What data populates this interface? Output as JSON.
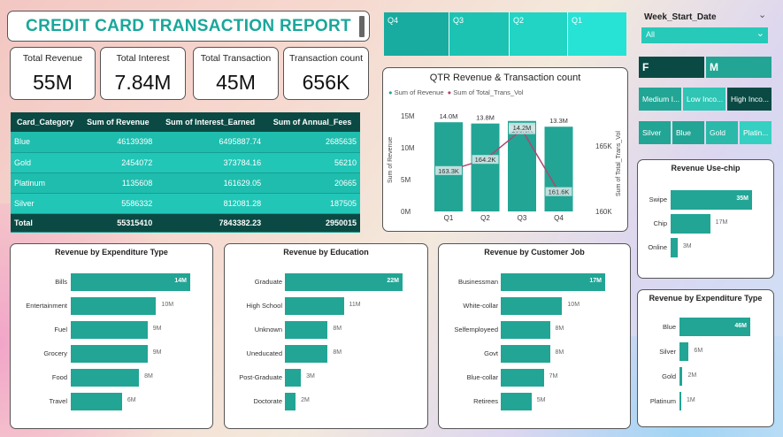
{
  "report": {
    "title": "CREDIT CARD TRANSACTION REPORT"
  },
  "kpis": [
    {
      "label": "Total Revenue",
      "value": "55M"
    },
    {
      "label": "Total Interest",
      "value": "7.84M"
    },
    {
      "label": "Total Transaction",
      "value": "45M"
    },
    {
      "label": "Transaction count",
      "value": "656K"
    }
  ],
  "table": {
    "headers": [
      "Card_Category",
      "Sum of Revenue",
      "Sum of Interest_Earned",
      "Sum of Annual_Fees"
    ],
    "rows": [
      [
        "Blue",
        "46139398",
        "6495887.74",
        "2685635"
      ],
      [
        "Gold",
        "2454072",
        "373784.16",
        "56210"
      ],
      [
        "Platinum",
        "1135608",
        "161629.05",
        "20665"
      ],
      [
        "Silver",
        "5586332",
        "812081.28",
        "187505"
      ]
    ],
    "total": [
      "Total",
      "55315410",
      "7843382.23",
      "2950015"
    ]
  },
  "quarter_slicer": [
    "Q4",
    "Q3",
    "Q2",
    "Q1"
  ],
  "week_slicer": {
    "label": "Week_Start_Date",
    "value": "All"
  },
  "gender_slicer": [
    "F",
    "M"
  ],
  "income_slicer": [
    "Medium I...",
    "Low Inco...",
    "High Inco..."
  ],
  "card_slicer": [
    "Silver",
    "Blue",
    "Gold",
    "Platin..."
  ],
  "qtr_chart": {
    "title": "QTR Revenue & Transaction count",
    "legend": [
      "Sum of Revenue",
      "Sum of Total_Trans_Vol"
    ],
    "ylabel_left": "Sum of Revenue",
    "ylabel_right": "Sum of Total_Trans_Vol",
    "left_ticks": [
      "15M",
      "10M",
      "5M",
      "0M"
    ],
    "right_ticks": [
      "165K",
      "160K"
    ]
  },
  "colors": {
    "teal": "#22a595",
    "dark_teal": "#0b4a44",
    "line": "#b0466f",
    "title": "#1aa79a"
  },
  "chart_data": [
    {
      "type": "bar+line",
      "title": "QTR Revenue & Transaction count",
      "categories": [
        "Q1",
        "Q2",
        "Q3",
        "Q4"
      ],
      "series": [
        {
          "name": "Sum of Revenue",
          "type": "bar",
          "values": [
            14.0,
            13.8,
            14.2,
            13.3
          ],
          "labels": [
            "14.0M",
            "13.8M",
            "14.2M",
            "13.3M"
          ]
        },
        {
          "name": "Sum of Total_Trans_Vol",
          "type": "line",
          "values": [
            163.3,
            164.2,
            166.6,
            161.6
          ],
          "labels": [
            "163.3K",
            "164.2K",
            "166.6K",
            "161.6K"
          ]
        }
      ],
      "ylim": [
        0,
        15
      ],
      "y2lim": [
        160,
        167
      ]
    },
    {
      "type": "bar",
      "title": "Revenue by Expenditure Type",
      "categories": [
        "Bills",
        "Entertainment",
        "Fuel",
        "Grocery",
        "Food",
        "Travel"
      ],
      "values": [
        14,
        10,
        9,
        9,
        8,
        6
      ],
      "labels": [
        "14M",
        "10M",
        "9M",
        "9M",
        "8M",
        "6M"
      ]
    },
    {
      "type": "bar",
      "title": "Revenue by Education",
      "categories": [
        "Graduate",
        "High School",
        "Unknown",
        "Uneducated",
        "Post-Graduate",
        "Doctorate"
      ],
      "values": [
        22,
        11,
        8,
        8,
        3,
        2
      ],
      "labels": [
        "22M",
        "11M",
        "8M",
        "8M",
        "3M",
        "2M"
      ]
    },
    {
      "type": "bar",
      "title": "Revenue by Customer Job",
      "categories": [
        "Businessman",
        "White-collar",
        "Selfemployeed",
        "Govt",
        "Blue-collar",
        "Retirees"
      ],
      "values": [
        17,
        10,
        8,
        8,
        7,
        5
      ],
      "labels": [
        "17M",
        "10M",
        "8M",
        "8M",
        "7M",
        "5M"
      ]
    },
    {
      "type": "bar",
      "title": "Revenue Use-chip",
      "categories": [
        "Swipe",
        "Chip",
        "Online"
      ],
      "values": [
        35,
        17,
        3
      ],
      "labels": [
        "35M",
        "17M",
        "3M"
      ]
    },
    {
      "type": "bar",
      "title": "Revenue by Expenditure Type",
      "categories": [
        "Blue",
        "Silver",
        "Gold",
        "Platinum"
      ],
      "values": [
        46,
        6,
        2,
        1
      ],
      "labels": [
        "46M",
        "6M",
        "2M",
        "1M"
      ]
    }
  ]
}
